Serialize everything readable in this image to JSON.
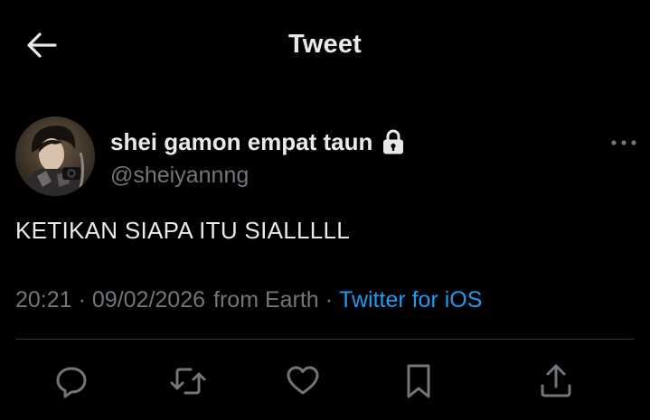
{
  "header": {
    "title": "Tweet",
    "back_icon": "arrow-left-icon"
  },
  "author": {
    "display_name": "shei gamon empat taun",
    "handle": "@sheiyannng",
    "protected_icon": "lock-icon",
    "more_icon": "more-horizontal-icon"
  },
  "tweet": {
    "text": "KETIKAN SIAPA ITU SIALLLLL",
    "time": "20:21",
    "date": "09/02/2026",
    "location": "from Earth",
    "separator": "·",
    "source": "Twitter for iOS"
  },
  "actions": {
    "reply_icon": "reply-icon",
    "retweet_icon": "retweet-icon",
    "like_icon": "heart-icon",
    "bookmark_icon": "bookmark-icon",
    "share_icon": "share-icon"
  },
  "colors": {
    "background": "#000000",
    "text_primary": "#e7e9ea",
    "text_secondary": "#71767b",
    "link": "#1d9bf0",
    "divider": "#2f3336"
  }
}
